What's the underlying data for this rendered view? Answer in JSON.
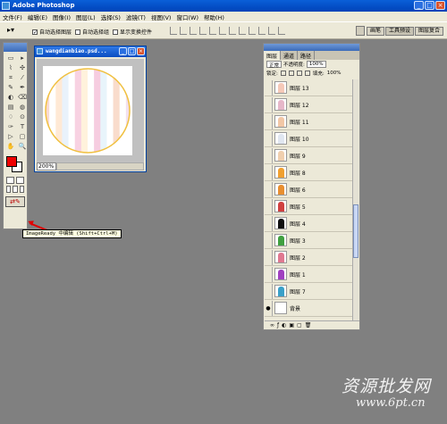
{
  "app": {
    "title": "Adobe Photoshop"
  },
  "menu": [
    "文件(F)",
    "编辑(E)",
    "图像(I)",
    "图层(L)",
    "选择(S)",
    "滤镜(T)",
    "视图(V)",
    "窗口(W)",
    "帮助(H)"
  ],
  "options": {
    "auto_select_layer": "自动选择图层",
    "auto_select_group": "自动选择组",
    "show_transform": "显示变换控件"
  },
  "well": {
    "tabs": [
      "画笔",
      "工具预设",
      "图层复合"
    ]
  },
  "toolbox": {
    "tools": [
      "▭",
      "▸",
      "⌇",
      "✣",
      "⌗",
      "⁄",
      "✎",
      "✒",
      "◐",
      "⌫",
      "▤",
      "◍",
      "♢",
      "⊙",
      "✑",
      "T",
      "▷",
      "▢",
      "✋",
      "🔍"
    ],
    "fg_color": "#ee0000",
    "bg_color": "#ffffff"
  },
  "tooltip": "ImageReady 中编辑 (Shift+Ctrl+M)",
  "document": {
    "filename": "wangdianbiao.psd...",
    "zoom": "200%",
    "stripes": [
      "#f9d9d3",
      "#ffffff",
      "#ffe9d5",
      "#e9f2fb",
      "#ffffff",
      "#f8d2e2",
      "#fff2dc",
      "#ffffff",
      "#f6cde0",
      "#e8f4fb",
      "#ffffff",
      "#f9dccc",
      "#ffffff",
      "#f3e0ee"
    ]
  },
  "layers_panel": {
    "tabs": [
      "图层",
      "通道",
      "路径"
    ],
    "blend_mode": "正常",
    "opacity_label": "不透明度:",
    "opacity": "100%",
    "lock_label": "锁定:",
    "fill_label": "填充:",
    "fill": "100%",
    "rows": [
      {
        "name": "图层 13",
        "color": "#f5c9b8",
        "eye": ""
      },
      {
        "name": "图层 12",
        "color": "#e6b7c9",
        "eye": ""
      },
      {
        "name": "图层 11",
        "color": "#f2c7a6",
        "eye": ""
      },
      {
        "name": "图层 10",
        "color": "#e0e6f0",
        "eye": ""
      },
      {
        "name": "图层 9",
        "color": "#f0cfae",
        "eye": ""
      },
      {
        "name": "图层 8",
        "color": "#f0a030",
        "eye": ""
      },
      {
        "name": "图层 6",
        "color": "#e88f30",
        "eye": ""
      },
      {
        "name": "图层 5",
        "color": "#d04040",
        "eye": ""
      },
      {
        "name": "图层 4",
        "color": "#101010",
        "eye": ""
      },
      {
        "name": "图层 3",
        "color": "#40a040",
        "eye": ""
      },
      {
        "name": "图层 2",
        "color": "#e07890",
        "eye": ""
      },
      {
        "name": "图层 1",
        "color": "#a040c0",
        "eye": ""
      },
      {
        "name": "图层 7",
        "color": "#3aa0c8",
        "eye": ""
      },
      {
        "name": "背景",
        "color": "#ffffff",
        "eye": "●"
      }
    ],
    "footer": [
      "∞",
      "ƒ",
      "◐",
      "▣",
      "▢",
      "🗑"
    ]
  },
  "watermark": {
    "text": "资源批发网",
    "url": "www.6pt.cn"
  }
}
